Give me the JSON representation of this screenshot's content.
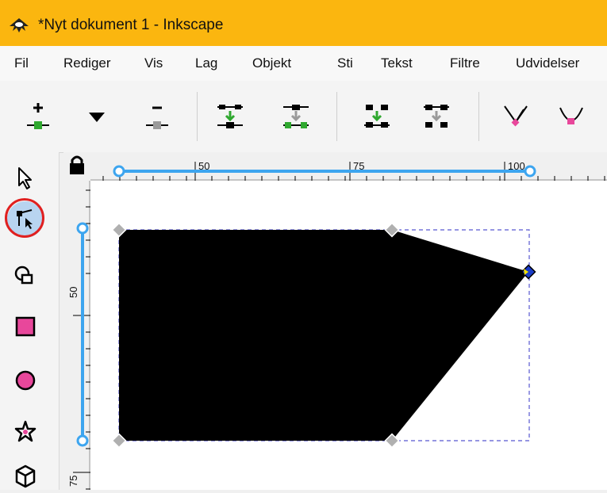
{
  "window": {
    "title": "*Nyt dokument 1 - Inkscape"
  },
  "menu": {
    "items": [
      "Fil",
      "Rediger",
      "Vis",
      "Lag",
      "Objekt",
      "Sti",
      "Tekst",
      "Filtre",
      "Udvidelser"
    ]
  },
  "toolbar": {
    "buttons": [
      "insert-node-icon",
      "insert-node-dropdown-icon",
      "delete-node-icon",
      "join-nodes-icon",
      "break-path-icon",
      "join-segment-icon",
      "delete-segment-icon",
      "cusp-node-icon",
      "smooth-node-icon"
    ]
  },
  "toolbox": {
    "tools": [
      "selector-tool-icon",
      "node-tool-icon",
      "tweak-tool-icon",
      "rectangle-tool-icon",
      "ellipse-tool-icon",
      "star-tool-icon",
      "box-3d-tool-icon"
    ],
    "active_tool": "node-tool-icon"
  },
  "rulers": {
    "horizontal_labels": [
      "50",
      "75",
      "100"
    ],
    "vertical_labels": [
      "50",
      "75"
    ]
  },
  "colors": {
    "titlebar": "#fbb60f",
    "shape_fill": "#000000",
    "guide_blue": "#3da5ef",
    "selected_node": "#1a3cc8",
    "node_gray": "#b0b0b0",
    "bbox_dash": "#5858d0",
    "accent_pink": "#e8479b",
    "green_plus": "#2fa82f",
    "highlight_ring": "#e02020"
  }
}
